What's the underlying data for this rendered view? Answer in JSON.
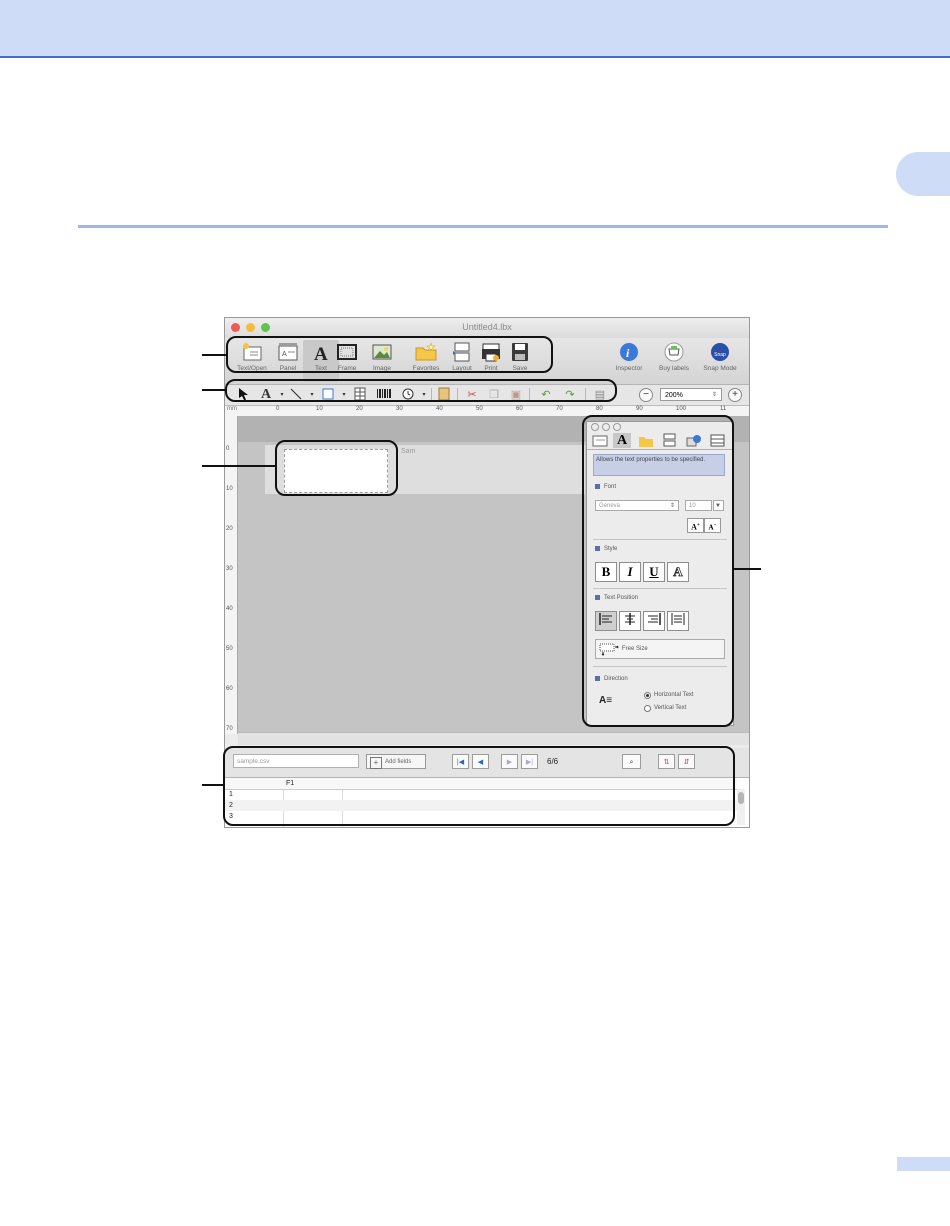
{
  "window": {
    "title": "Untitled4.lbx"
  },
  "toolbar": {
    "items": [
      {
        "label": "Text/Open",
        "icon": "new-open-icon"
      },
      {
        "label": "Panel",
        "icon": "paper-icon"
      },
      {
        "label": "Text",
        "icon": "text-icon"
      },
      {
        "label": "Frame",
        "icon": "frame-icon"
      },
      {
        "label": "Image",
        "icon": "image-icon"
      },
      {
        "label": "Favorites",
        "icon": "favorites-icon"
      },
      {
        "label": "Layout",
        "icon": "layout-icon"
      },
      {
        "label": "Print",
        "icon": "print-icon"
      },
      {
        "label": "Save",
        "icon": "save-icon"
      }
    ],
    "right": [
      {
        "label": "Inspector",
        "icon": "inspector-icon"
      },
      {
        "label": "Buy labels",
        "icon": "buy-labels-icon"
      },
      {
        "label": "Snap Mode",
        "icon": "snap-mode-icon",
        "badge": "Snap"
      }
    ]
  },
  "draw_toolbar": {
    "zoom": "200%",
    "zoom_out": "−",
    "zoom_in": "+"
  },
  "ruler": {
    "unit": "mm",
    "top": [
      "0",
      "10",
      "20",
      "30",
      "40",
      "50",
      "60",
      "70",
      "80",
      "90",
      "100",
      "11"
    ],
    "left": [
      "0",
      "10",
      "20",
      "30",
      "40",
      "50",
      "60",
      "70"
    ]
  },
  "canvas": {
    "label_text": "Sam"
  },
  "inspector": {
    "description": "Allows the text properties to be specified.",
    "font_head": "Font",
    "font_name": "Geneva",
    "font_size": "10",
    "style_head": "Style",
    "style_buttons": [
      "B",
      "I",
      "U",
      "A"
    ],
    "position_head": "Text Position",
    "free_size": "Free Size",
    "direction_head": "Direction",
    "direction_options": [
      "Horizontal Text",
      "Vertical Text"
    ]
  },
  "database": {
    "file": "sample.csv",
    "add_fields": "Add fields",
    "record_count": "6/6",
    "column": "F1",
    "rows": [
      "1",
      "2",
      "3"
    ]
  }
}
